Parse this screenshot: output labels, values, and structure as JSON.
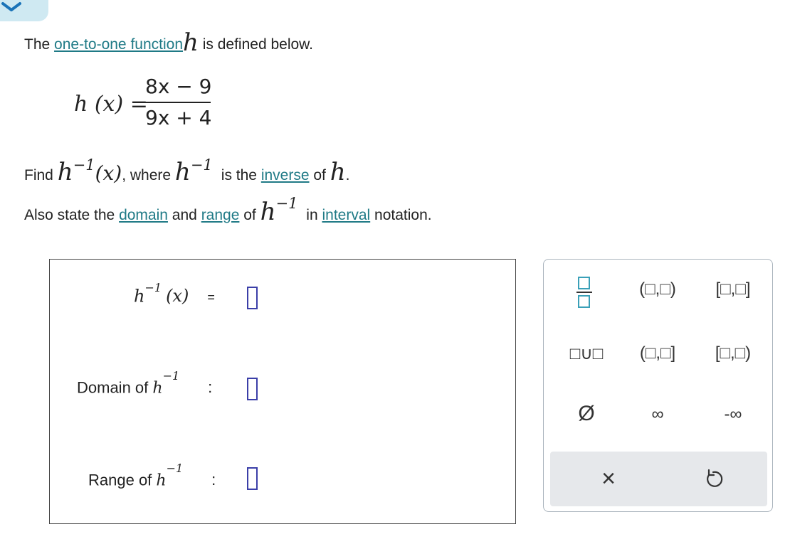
{
  "question": {
    "line1": {
      "prefix": "The ",
      "link": "one-to-one function",
      "var": "h",
      "suffix": " is defined below."
    },
    "formula": {
      "lhs": "h (x) =",
      "numerator": "8x − 9",
      "denominator": "9x + 4"
    },
    "line2": {
      "find": "Find ",
      "h": "h",
      "exp": "−1",
      "arg": "(x)",
      "where": ", where ",
      "h2": "h",
      "exp2": "−1",
      "is_the": "is the ",
      "link": "inverse",
      "of": " of ",
      "h3": "h",
      "end": "."
    },
    "line3": {
      "prefix": "Also state the ",
      "link_domain": "domain",
      "and": " and ",
      "link_range": "range",
      "of": " of ",
      "h": "h",
      "exp": "−1",
      "in": " in ",
      "link_interval": "interval",
      "suffix": " notation."
    }
  },
  "answer": {
    "inverse_row": {
      "h": "h",
      "exp": "−1",
      "arg": "(x)",
      "equals": "="
    },
    "domain_row": {
      "label": "Domain of ",
      "h": "h",
      "exp": "−1",
      "colon": ":"
    },
    "range_row": {
      "label": "Range of ",
      "h": "h",
      "exp": "−1",
      "colon": ":"
    }
  },
  "keypad": {
    "keys": {
      "open_open": "(□,□)",
      "closed_closed": "[□,□]",
      "union": "□∪□",
      "open_closed": "(□,□]",
      "closed_open": "[□,□)",
      "empty_set": "Ø",
      "infinity": "∞",
      "neg_infinity": "-∞",
      "clear": "×"
    },
    "icons": [
      "fraction-icon",
      "undo-icon",
      "chevron-down-icon"
    ]
  },
  "colors": {
    "link": "#1f7a86",
    "slot_border": "#3b3fa8",
    "tab_bg": "#cfe9f2",
    "keypad_bar": "#e6e8eb"
  }
}
